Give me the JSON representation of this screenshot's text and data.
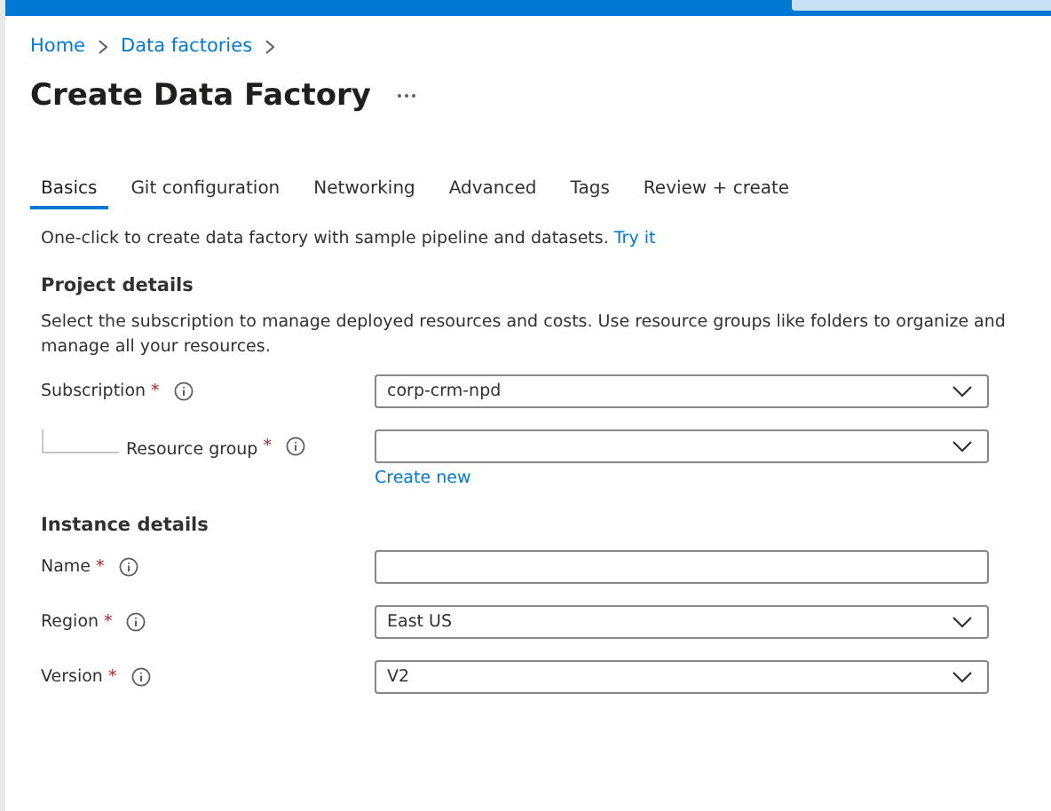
{
  "breadcrumb": [
    {
      "label": "Home"
    },
    {
      "label": "Data factories"
    }
  ],
  "title": "Create Data Factory",
  "tabs": [
    {
      "label": "Basics",
      "selected": true
    },
    {
      "label": "Git configuration",
      "selected": false
    },
    {
      "label": "Networking",
      "selected": false
    },
    {
      "label": "Advanced",
      "selected": false
    },
    {
      "label": "Tags",
      "selected": false
    },
    {
      "label": "Review + create",
      "selected": false
    }
  ],
  "intro": {
    "text": "One-click to create data factory with sample pipeline and datasets.",
    "link": "Try it"
  },
  "sections": [
    {
      "heading": "Project details",
      "description": "Select the subscription to manage deployed resources and costs. Use resource groups like folders to organize and manage all your resources.",
      "fields": [
        {
          "label": "Subscription",
          "required_mark": "*",
          "kind": "dropdown",
          "value": "corp-crm-npd",
          "indented": false
        },
        {
          "label": "Resource group",
          "required_mark": "*",
          "kind": "dropdown",
          "indented": true,
          "link": "Create new"
        }
      ]
    },
    {
      "heading": "Instance details",
      "fields": [
        {
          "label": "Name",
          "required_mark": "*",
          "kind": "text",
          "indented": false
        },
        {
          "label": "Region",
          "required_mark": "*",
          "kind": "dropdown",
          "value": "East US",
          "indented": false
        },
        {
          "label": "Version",
          "required_mark": "*",
          "kind": "dropdown",
          "value": "V2",
          "indented": false
        }
      ]
    }
  ]
}
